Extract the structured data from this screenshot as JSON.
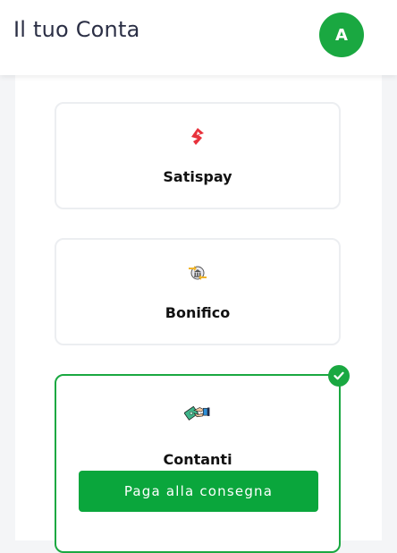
{
  "header": {
    "title": "Il tuo Conta",
    "avatar_initial": "A"
  },
  "payment_methods": [
    {
      "label": "Satispay",
      "icon": "satispay-icon",
      "selected": false
    },
    {
      "label": "Bonifico",
      "icon": "bank-transfer-icon",
      "selected": false
    },
    {
      "label": "Contanti",
      "icon": "cash-handshake-icon",
      "selected": true,
      "action_label": "Paga alla consegna"
    }
  ],
  "colors": {
    "accent_green": "#1aa841",
    "button_green": "#0aa63c",
    "satispay_red": "#e8323c"
  }
}
